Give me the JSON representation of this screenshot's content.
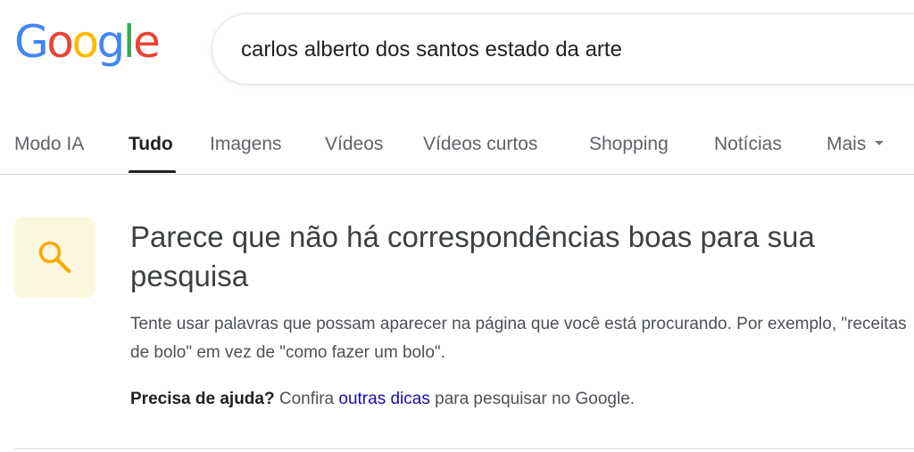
{
  "logo": {
    "letters": [
      "G",
      "o",
      "o",
      "g",
      "l",
      "e"
    ],
    "colors": [
      "#4285F4",
      "#EA4335",
      "#FBBC05",
      "#4285F4",
      "#34A853",
      "#EA4335"
    ]
  },
  "search": {
    "value": "carlos alberto dos santos estado da arte"
  },
  "tabs": [
    {
      "label": "Modo IA",
      "active": false
    },
    {
      "label": "Tudo",
      "active": true
    },
    {
      "label": "Imagens",
      "active": false
    },
    {
      "label": "Vídeos",
      "active": false
    },
    {
      "label": "Vídeos curtos",
      "active": false
    },
    {
      "label": "Shopping",
      "active": false
    },
    {
      "label": "Notícias",
      "active": false
    },
    {
      "label": "Mais",
      "active": false
    }
  ],
  "result": {
    "icon": "search-icon",
    "icon_color": "#F9AB00",
    "heading": "Parece que não há correspondências boas para sua pesquisa",
    "hint": "Tente usar palavras que possam aparecer na página que você está procurando. Por exemplo, \"receitas de bolo\" em vez de \"como fazer um bolo\".",
    "help_bold": "Precisa de ajuda?",
    "help_pre": " Confira ",
    "help_link": "outras dicas",
    "help_post": " para pesquisar no Google."
  },
  "colors": {
    "link": "#1a0dab",
    "active_tab": "#202124",
    "inactive_tab": "#5f6368"
  }
}
